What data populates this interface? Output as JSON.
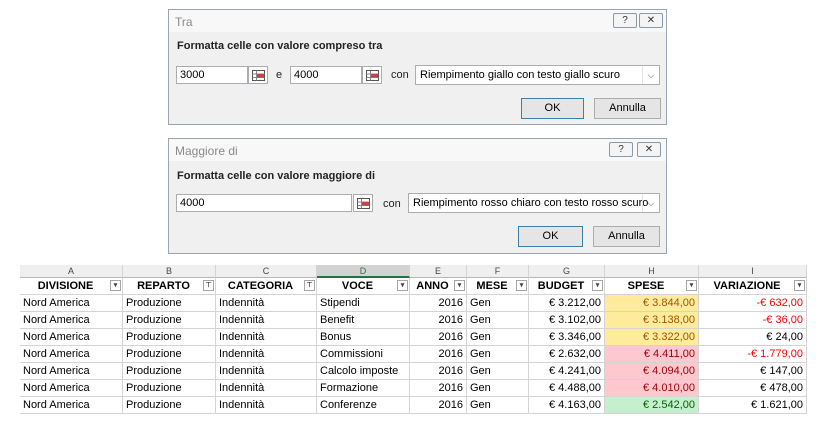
{
  "dialog_between": {
    "title": "Tra",
    "help": "?",
    "close": "✕",
    "heading": "Formatta celle con valore compreso tra",
    "value1": "3000",
    "and_label": "e",
    "value2": "4000",
    "with_label": "con",
    "format": "Riempimento giallo con testo giallo scuro",
    "ok": "OK",
    "cancel": "Annulla"
  },
  "dialog_greater": {
    "title": "Maggiore di",
    "help": "?",
    "close": "✕",
    "heading": "Formatta celle con valore maggiore di",
    "value": "4000",
    "with_label": "con",
    "format": "Riempimento rosso chiaro con testo rosso scuro",
    "ok": "OK",
    "cancel": "Annulla"
  },
  "sheet": {
    "columns": [
      "A",
      "B",
      "C",
      "D",
      "E",
      "F",
      "G",
      "H",
      "I"
    ],
    "headers": [
      "DIVISIONE",
      "REPARTO",
      "CATEGORIA",
      "VOCE",
      "ANNO",
      "MESE",
      "BUDGET",
      "SPESE",
      "VARIAZIONE"
    ],
    "rows": [
      [
        "Nord America",
        "Produzione",
        "Indennità",
        "Stipendi",
        "2016",
        "Gen",
        "€ 3.212,00",
        "€ 3.844,00",
        "-€ 632,00"
      ],
      [
        "Nord America",
        "Produzione",
        "Indennità",
        "Benefit",
        "2016",
        "Gen",
        "€ 3.102,00",
        "€ 3.138,00",
        "-€ 36,00"
      ],
      [
        "Nord America",
        "Produzione",
        "Indennità",
        "Bonus",
        "2016",
        "Gen",
        "€ 3.346,00",
        "€ 3.322,00",
        "€ 24,00"
      ],
      [
        "Nord America",
        "Produzione",
        "Indennità",
        "Commissioni",
        "2016",
        "Gen",
        "€ 2.632,00",
        "€ 4.411,00",
        "-€ 1.779,00"
      ],
      [
        "Nord America",
        "Produzione",
        "Indennità",
        "Calcolo imposte",
        "2016",
        "Gen",
        "€ 4.241,00",
        "€ 4.094,00",
        "€ 147,00"
      ],
      [
        "Nord America",
        "Produzione",
        "Indennità",
        "Formazione",
        "2016",
        "Gen",
        "€ 4.488,00",
        "€ 4.010,00",
        "€ 478,00"
      ],
      [
        "Nord America",
        "Produzione",
        "Indennità",
        "Conferenze",
        "2016",
        "Gen",
        "€ 4.163,00",
        "€ 2.542,00",
        "€ 1.621,00"
      ]
    ],
    "spese_fill": [
      "yellow",
      "yellow",
      "yellow",
      "red",
      "red",
      "red",
      "green"
    ],
    "variazione_negative": [
      true,
      true,
      false,
      true,
      false,
      false,
      false
    ]
  }
}
